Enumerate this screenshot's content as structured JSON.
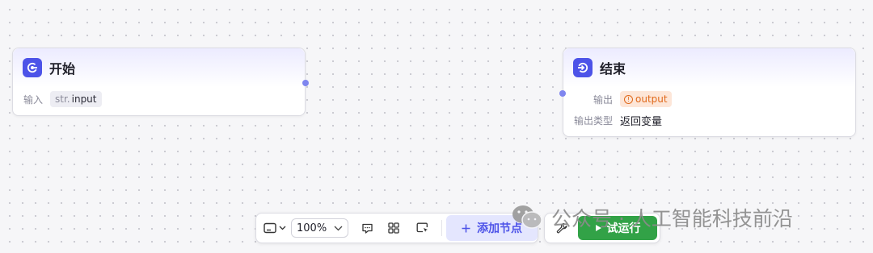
{
  "start_node": {
    "title": "开始",
    "icon": "start-node-icon",
    "fields": [
      {
        "label": "输入",
        "type": "str.",
        "name": "input"
      }
    ]
  },
  "end_node": {
    "title": "结束",
    "icon": "end-node-icon",
    "output_label": "输出",
    "output_value": "output",
    "output_type_label": "输出类型",
    "output_type_value": "返回变量"
  },
  "toolbar": {
    "zoom": "100%",
    "add_node_label": "添加节点",
    "run_label": "试运行"
  },
  "watermark": {
    "text": "公众号 · 人工智能科技前沿"
  },
  "colors": {
    "accent": "#4d53e8",
    "run": "#32a247",
    "warning": "#e0691b",
    "port": "#7f86ef"
  }
}
